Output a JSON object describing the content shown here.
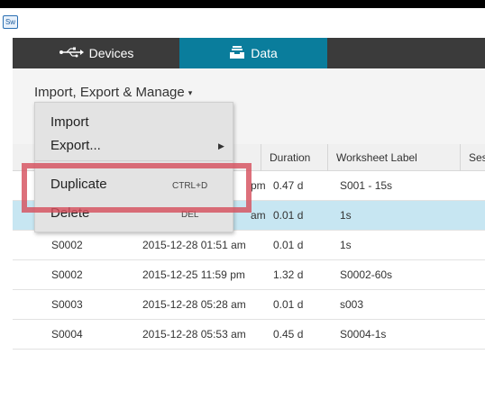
{
  "app": {
    "icon_text": "Sw"
  },
  "nav": {
    "tabs": [
      {
        "label": "Devices",
        "icon": "usb-icon"
      },
      {
        "label": "Data",
        "icon": "tray-icon"
      }
    ]
  },
  "toolbar": {
    "manage_label": "Import, Export & Manage",
    "manage_caret": "▾"
  },
  "menu": {
    "items": [
      {
        "label": "Import",
        "shortcut": ""
      },
      {
        "label": "Export...",
        "shortcut": "",
        "submenu_arrow": "▶"
      },
      {
        "label": "Duplicate",
        "shortcut": "CTRL+D"
      },
      {
        "label": "Delete",
        "shortcut": "DEL"
      }
    ]
  },
  "table": {
    "columns": [
      "Duration",
      "Worksheet Label",
      "Ses"
    ],
    "rows": [
      {
        "sensor": "",
        "date": "pm",
        "duration": "0.47 d",
        "label": "S001 - 15s",
        "selected": false
      },
      {
        "sensor": "",
        "date": "am",
        "duration": "0.01 d",
        "label": "1s",
        "selected": true
      },
      {
        "sensor": "S0002",
        "date": "2015-12-28 01:51 am",
        "duration": "0.01 d",
        "label": "1s",
        "selected": false
      },
      {
        "sensor": "S0002",
        "date": "2015-12-25 11:59 pm",
        "duration": "1.32 d",
        "label": "S0002-60s",
        "selected": false
      },
      {
        "sensor": "S0003",
        "date": "2015-12-28 05:28 am",
        "duration": "0.01 d",
        "label": "s003",
        "selected": false
      },
      {
        "sensor": "S0004",
        "date": "2015-12-28 05:53 am",
        "duration": "0.45 d",
        "label": "S0004-1s",
        "selected": false
      }
    ]
  },
  "colors": {
    "nav_bg": "#3b3b3b",
    "active_tab": "#0a7d9c",
    "selected_row": "#c7e6f2",
    "highlight_box": "#d6505e"
  }
}
